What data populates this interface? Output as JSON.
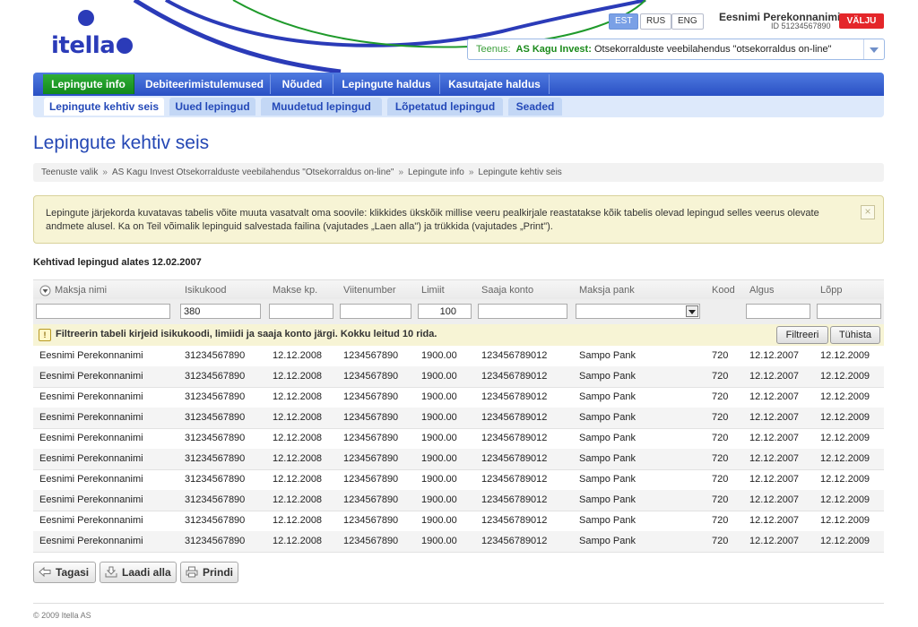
{
  "header": {
    "logo_text": "itella",
    "languages": [
      {
        "code": "EST",
        "active": true
      },
      {
        "code": "RUS",
        "active": false
      },
      {
        "code": "ENG",
        "active": false
      }
    ],
    "user_name": "Eesnimi Perekonnanimi",
    "user_id": "ID 51234567890",
    "logout_label": "VÄLJU",
    "service_label": "Teenus:",
    "service_company": "AS Kagu Invest:",
    "service_description": "Otsekorralduste veebilahendus \"otsekorraldus on-line\""
  },
  "nav": {
    "items": [
      {
        "label": "Lepingute info",
        "active": true
      },
      {
        "label": "Debiteerimistulemused",
        "active": false
      },
      {
        "label": "Nõuded",
        "active": false
      },
      {
        "label": "Lepingute haldus",
        "active": false
      },
      {
        "label": "Kasutajate haldus",
        "active": false
      }
    ],
    "subitems": [
      {
        "label": "Lepingute kehtiv seis",
        "active": true
      },
      {
        "label": "Uued lepingud",
        "active": false
      },
      {
        "label": "Muudetud lepingud",
        "active": false
      },
      {
        "label": "Lõpetatud lepingud",
        "active": false
      },
      {
        "label": "Seaded",
        "active": false
      }
    ]
  },
  "page": {
    "title": "Lepingute kehtiv seis",
    "breadcrumb": [
      "Teenuste valik",
      "AS Kagu Invest Otsekorralduste veebilahendus \"Otsekorraldus on-line\"",
      "Lepingute info",
      "Lepingute kehtiv seis"
    ],
    "breadcrumb_separator": "»",
    "info_text": "Lepingute järjekorda kuvatavas tabelis võite muuta vasatvalt oma soovile: klikkides ükskõik millise veeru pealkirjale reastatakse kõik tabelis olevad lepingud selles veerus olevate andmete alusel. Ka on Teil võimalik lepinguid salvestada failina (vajutades „Laen alla\") ja trükkida (vajutades „Print\").",
    "info_close": "×",
    "section_title": "Kehtivad lepingud alates 12.02.2007"
  },
  "table": {
    "columns": [
      "Maksja nimi",
      "Isikukood",
      "Makse kp.",
      "Viitenumber",
      "Limiit",
      "Saaja konto",
      "Maksja pank",
      "Kood",
      "Algus",
      "Lõpp"
    ],
    "filters": {
      "maksja_nimi": "",
      "isikukood": "380",
      "makse_kp": "",
      "viitenumber": "",
      "limiit": "100",
      "saaja_konto": "",
      "maksja_pank": "",
      "algus": "",
      "lopp": ""
    },
    "notice_icon": "!",
    "notice": "Filtreerin tabeli kirjeid isikukoodi, limiidi ja saaja konto järgi. Kokku leitud 10 rida.",
    "filter_button": "Filtreeri",
    "clear_button": "Tühista",
    "rows": [
      [
        "Eesnimi Perekonnanimi",
        "31234567890",
        "12.12.2008",
        "1234567890",
        "1900.00",
        "123456789012",
        "Sampo Pank",
        "720",
        "12.12.2007",
        "12.12.2009"
      ],
      [
        "Eesnimi Perekonnanimi",
        "31234567890",
        "12.12.2008",
        "1234567890",
        "1900.00",
        "123456789012",
        "Sampo Pank",
        "720",
        "12.12.2007",
        "12.12.2009"
      ],
      [
        "Eesnimi Perekonnanimi",
        "31234567890",
        "12.12.2008",
        "1234567890",
        "1900.00",
        "123456789012",
        "Sampo Pank",
        "720",
        "12.12.2007",
        "12.12.2009"
      ],
      [
        "Eesnimi Perekonnanimi",
        "31234567890",
        "12.12.2008",
        "1234567890",
        "1900.00",
        "123456789012",
        "Sampo Pank",
        "720",
        "12.12.2007",
        "12.12.2009"
      ],
      [
        "Eesnimi Perekonnanimi",
        "31234567890",
        "12.12.2008",
        "1234567890",
        "1900.00",
        "123456789012",
        "Sampo Pank",
        "720",
        "12.12.2007",
        "12.12.2009"
      ],
      [
        "Eesnimi Perekonnanimi",
        "31234567890",
        "12.12.2008",
        "1234567890",
        "1900.00",
        "123456789012",
        "Sampo Pank",
        "720",
        "12.12.2007",
        "12.12.2009"
      ],
      [
        "Eesnimi Perekonnanimi",
        "31234567890",
        "12.12.2008",
        "1234567890",
        "1900.00",
        "123456789012",
        "Sampo Pank",
        "720",
        "12.12.2007",
        "12.12.2009"
      ],
      [
        "Eesnimi Perekonnanimi",
        "31234567890",
        "12.12.2008",
        "1234567890",
        "1900.00",
        "123456789012",
        "Sampo Pank",
        "720",
        "12.12.2007",
        "12.12.2009"
      ],
      [
        "Eesnimi Perekonnanimi",
        "31234567890",
        "12.12.2008",
        "1234567890",
        "1900.00",
        "123456789012",
        "Sampo Pank",
        "720",
        "12.12.2007",
        "12.12.2009"
      ],
      [
        "Eesnimi Perekonnanimi",
        "31234567890",
        "12.12.2008",
        "1234567890",
        "1900.00",
        "123456789012",
        "Sampo Pank",
        "720",
        "12.12.2007",
        "12.12.2009"
      ]
    ]
  },
  "actions": {
    "back": "Tagasi",
    "download": "Laadi alla",
    "print": "Prindi"
  },
  "footer": {
    "copyright": "© 2009 Itella AS"
  },
  "colors": {
    "brand_blue": "#2b3bb8",
    "nav_blue": "#2a50c4",
    "active_green": "#12891b",
    "logout_red": "#e4262a"
  }
}
